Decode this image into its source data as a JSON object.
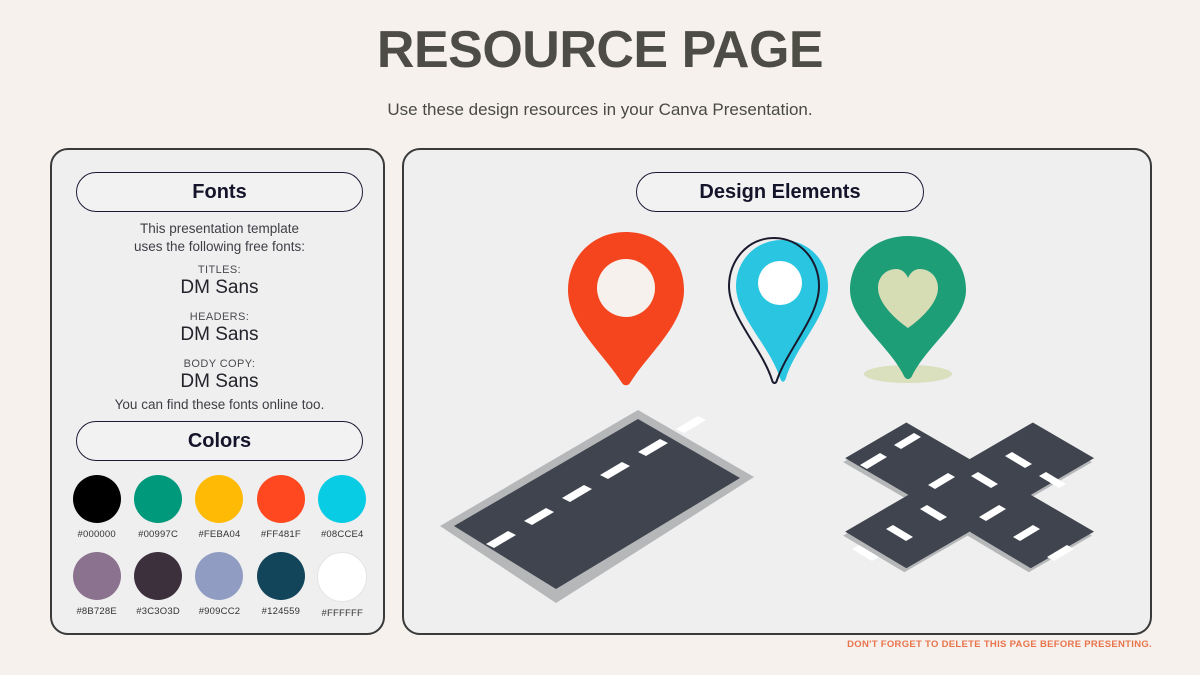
{
  "header": {
    "title": "RESOURCE PAGE",
    "subtitle": "Use these design resources in your Canva Presentation."
  },
  "fonts_panel": {
    "heading": "Fonts",
    "intro_line1": "This presentation template",
    "intro_line2": "uses the following free fonts:",
    "groups": [
      {
        "label": "TITLES:",
        "value": "DM Sans"
      },
      {
        "label": "HEADERS:",
        "value": "DM Sans"
      },
      {
        "label": "BODY COPY:",
        "value": "DM Sans"
      }
    ],
    "outro": "You can find these fonts online too."
  },
  "colors_panel": {
    "heading": "Colors",
    "swatches": [
      {
        "hex_label": "#000000",
        "hex": "#000000"
      },
      {
        "hex_label": "#00997C",
        "hex": "#00997C"
      },
      {
        "hex_label": "#FEBA04",
        "hex": "#FEBA04"
      },
      {
        "hex_label": "#FF481F",
        "hex": "#FF481F"
      },
      {
        "hex_label": "#08CCE4",
        "hex": "#08CCE4"
      },
      {
        "hex_label": "#8B728E",
        "hex": "#8B728E"
      },
      {
        "hex_label": "#3C3O3D",
        "hex": "#3C303D"
      },
      {
        "hex_label": "#909CC2",
        "hex": "#909CC2"
      },
      {
        "hex_label": "#124559",
        "hex": "#124559"
      },
      {
        "hex_label": "#FFFFFF",
        "hex": "#FFFFFF"
      }
    ]
  },
  "design_panel": {
    "heading": "Design Elements",
    "pins": [
      {
        "name": "red-location-pin",
        "fill": "#F4451E",
        "inner": "#F6F1ED",
        "inner_shape": "circle"
      },
      {
        "name": "cyan-outlined-location-pin",
        "fill": "#2AC5E0",
        "inner": "#FFFFFF",
        "inner_shape": "circle",
        "outline": "#1A1A2E"
      },
      {
        "name": "green-heart-location-pin",
        "fill": "#1E9E77",
        "inner": "#D6DCB4",
        "inner_shape": "heart",
        "shadow": "#D6DCB4"
      }
    ],
    "roads": [
      {
        "name": "straight-road-isometric",
        "asphalt": "#3F444E",
        "curb": "#B5B7B9",
        "dash": "#FFFFFF",
        "dashes": 6
      },
      {
        "name": "crossroad-intersection-isometric",
        "asphalt": "#3F444E",
        "curb": "#B5B7B9",
        "dash": "#FFFFFF"
      }
    ]
  },
  "footer": {
    "note": "DON'T FORGET TO DELETE THIS PAGE BEFORE PRESENTING."
  }
}
